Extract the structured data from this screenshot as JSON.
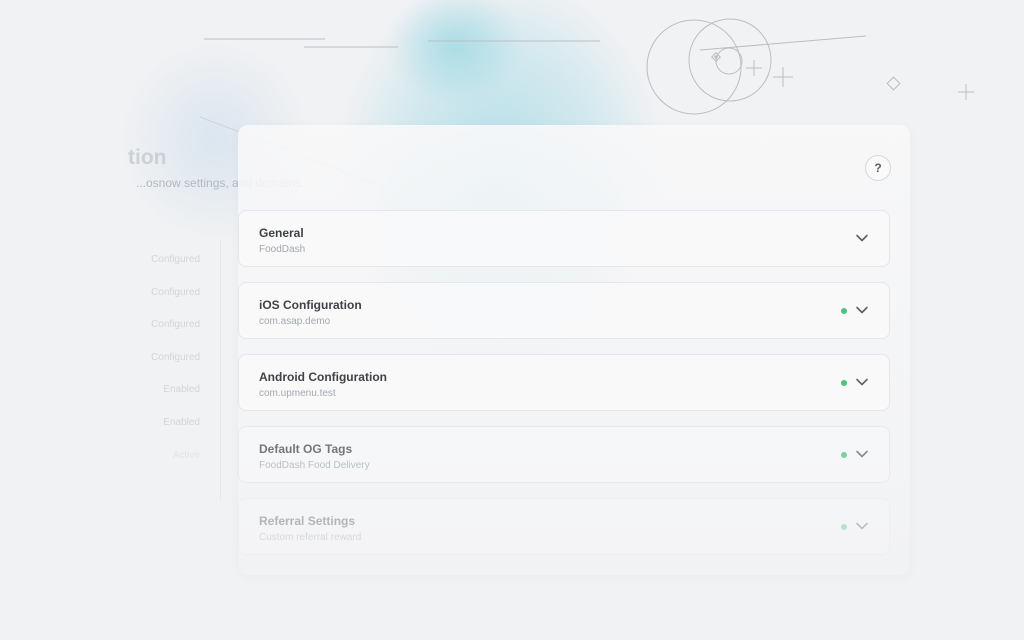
{
  "page": {
    "title_fragment": "tion",
    "subtitle_fragment": "...osnow settings, and domains."
  },
  "background_list": {
    "items": [
      {
        "status": "Configured"
      },
      {
        "status": "Configured"
      },
      {
        "status": "Configured"
      },
      {
        "status": "Configured"
      },
      {
        "status": "Enabled"
      },
      {
        "status": "Enabled"
      },
      {
        "status": "Active"
      }
    ]
  },
  "help_button": {
    "label": "?"
  },
  "sections": [
    {
      "title": "General",
      "subtitle": "FoodDash",
      "has_status": false
    },
    {
      "title": "iOS Configuration",
      "subtitle": "com.asap.demo",
      "has_status": true
    },
    {
      "title": "Android Configuration",
      "subtitle": "com.upmenu.test",
      "has_status": true
    },
    {
      "title": "Default OG Tags",
      "subtitle": "FoodDash Food Delivery",
      "has_status": true
    },
    {
      "title": "Referral Settings",
      "subtitle": "Custom referral reward",
      "has_status": true
    }
  ],
  "colors": {
    "status_active": "#4cc27a",
    "title_text": "#3f4247",
    "subtitle_text": "#a3a8ae",
    "accent_blob": "#a7dbe6",
    "chevron": "#5c6066"
  },
  "icons": {
    "help": "question-mark",
    "expand": "chevron-down-icon",
    "status": "status-dot"
  }
}
